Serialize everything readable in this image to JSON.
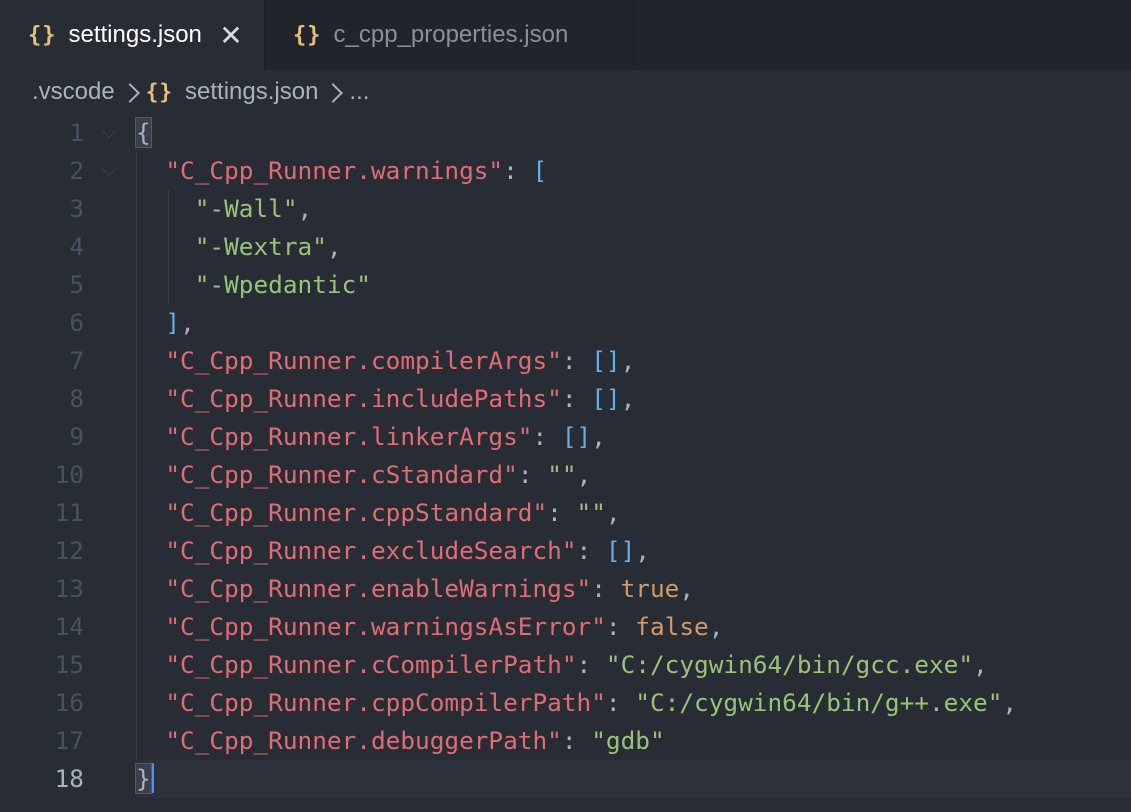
{
  "tabs": [
    {
      "icon": "{}",
      "label": "settings.json",
      "active": true,
      "close": "✕"
    },
    {
      "icon": "{}",
      "label": "c_cpp_properties.json",
      "active": false
    }
  ],
  "breadcrumb": {
    "folder": ".vscode",
    "file_icon": "{}",
    "file": "settings.json",
    "more": "..."
  },
  "editor": {
    "current_line": 18,
    "lines": [
      {
        "n": "1",
        "tokens": [
          {
            "t": "{",
            "c": "brace"
          }
        ]
      },
      {
        "n": "2",
        "tokens": [
          {
            "t": "  ",
            "c": "p"
          },
          {
            "t": "\"C_Cpp_Runner.warnings\"",
            "c": "k"
          },
          {
            "t": ": ",
            "c": "p"
          },
          {
            "t": "[",
            "c": "b"
          }
        ]
      },
      {
        "n": "3",
        "tokens": [
          {
            "t": "    ",
            "c": "p"
          },
          {
            "t": "\"-Wall\"",
            "c": "s"
          },
          {
            "t": ",",
            "c": "p"
          }
        ]
      },
      {
        "n": "4",
        "tokens": [
          {
            "t": "    ",
            "c": "p"
          },
          {
            "t": "\"-Wextra\"",
            "c": "s"
          },
          {
            "t": ",",
            "c": "p"
          }
        ]
      },
      {
        "n": "5",
        "tokens": [
          {
            "t": "    ",
            "c": "p"
          },
          {
            "t": "\"-Wpedantic\"",
            "c": "s"
          }
        ]
      },
      {
        "n": "6",
        "tokens": [
          {
            "t": "  ",
            "c": "p"
          },
          {
            "t": "]",
            "c": "b"
          },
          {
            "t": ",",
            "c": "p"
          }
        ]
      },
      {
        "n": "7",
        "tokens": [
          {
            "t": "  ",
            "c": "p"
          },
          {
            "t": "\"C_Cpp_Runner.compilerArgs\"",
            "c": "k"
          },
          {
            "t": ": ",
            "c": "p"
          },
          {
            "t": "[]",
            "c": "b"
          },
          {
            "t": ",",
            "c": "p"
          }
        ]
      },
      {
        "n": "8",
        "tokens": [
          {
            "t": "  ",
            "c": "p"
          },
          {
            "t": "\"C_Cpp_Runner.includePaths\"",
            "c": "k"
          },
          {
            "t": ": ",
            "c": "p"
          },
          {
            "t": "[]",
            "c": "b"
          },
          {
            "t": ",",
            "c": "p"
          }
        ]
      },
      {
        "n": "9",
        "tokens": [
          {
            "t": "  ",
            "c": "p"
          },
          {
            "t": "\"C_Cpp_Runner.linkerArgs\"",
            "c": "k"
          },
          {
            "t": ": ",
            "c": "p"
          },
          {
            "t": "[]",
            "c": "b"
          },
          {
            "t": ",",
            "c": "p"
          }
        ]
      },
      {
        "n": "10",
        "tokens": [
          {
            "t": "  ",
            "c": "p"
          },
          {
            "t": "\"C_Cpp_Runner.cStandard\"",
            "c": "k"
          },
          {
            "t": ": ",
            "c": "p"
          },
          {
            "t": "\"\"",
            "c": "s"
          },
          {
            "t": ",",
            "c": "p"
          }
        ]
      },
      {
        "n": "11",
        "tokens": [
          {
            "t": "  ",
            "c": "p"
          },
          {
            "t": "\"C_Cpp_Runner.cppStandard\"",
            "c": "k"
          },
          {
            "t": ": ",
            "c": "p"
          },
          {
            "t": "\"\"",
            "c": "s"
          },
          {
            "t": ",",
            "c": "p"
          }
        ]
      },
      {
        "n": "12",
        "tokens": [
          {
            "t": "  ",
            "c": "p"
          },
          {
            "t": "\"C_Cpp_Runner.excludeSearch\"",
            "c": "k"
          },
          {
            "t": ": ",
            "c": "p"
          },
          {
            "t": "[]",
            "c": "b"
          },
          {
            "t": ",",
            "c": "p"
          }
        ]
      },
      {
        "n": "13",
        "tokens": [
          {
            "t": "  ",
            "c": "p"
          },
          {
            "t": "\"C_Cpp_Runner.enableWarnings\"",
            "c": "k"
          },
          {
            "t": ": ",
            "c": "p"
          },
          {
            "t": "true",
            "c": "c"
          },
          {
            "t": ",",
            "c": "p"
          }
        ]
      },
      {
        "n": "14",
        "tokens": [
          {
            "t": "  ",
            "c": "p"
          },
          {
            "t": "\"C_Cpp_Runner.warningsAsError\"",
            "c": "k"
          },
          {
            "t": ": ",
            "c": "p"
          },
          {
            "t": "false",
            "c": "c"
          },
          {
            "t": ",",
            "c": "p"
          }
        ]
      },
      {
        "n": "15",
        "tokens": [
          {
            "t": "  ",
            "c": "p"
          },
          {
            "t": "\"C_Cpp_Runner.cCompilerPath\"",
            "c": "k"
          },
          {
            "t": ": ",
            "c": "p"
          },
          {
            "t": "\"C:/cygwin64/bin/gcc.exe\"",
            "c": "s"
          },
          {
            "t": ",",
            "c": "p"
          }
        ]
      },
      {
        "n": "16",
        "tokens": [
          {
            "t": "  ",
            "c": "p"
          },
          {
            "t": "\"C_Cpp_Runner.cppCompilerPath\"",
            "c": "k"
          },
          {
            "t": ": ",
            "c": "p"
          },
          {
            "t": "\"C:/cygwin64/bin/g++.exe\"",
            "c": "s"
          },
          {
            "t": ",",
            "c": "p"
          }
        ]
      },
      {
        "n": "17",
        "tokens": [
          {
            "t": "  ",
            "c": "p"
          },
          {
            "t": "\"C_Cpp_Runner.debuggerPath\"",
            "c": "k"
          },
          {
            "t": ": ",
            "c": "p"
          },
          {
            "t": "\"gdb\"",
            "c": "s"
          }
        ]
      },
      {
        "n": "18",
        "tokens": [
          {
            "t": "}",
            "c": "brace"
          },
          {
            "t": "",
            "c": "cursor"
          }
        ]
      }
    ]
  },
  "colors": {
    "background": "#282c34",
    "tabbar": "#21252b",
    "key": "#e06c75",
    "string": "#98c379",
    "bracket": "#61afef",
    "boolean": "#d19a66",
    "json_icon": "#e5c07b",
    "cursor": "#528bff"
  }
}
